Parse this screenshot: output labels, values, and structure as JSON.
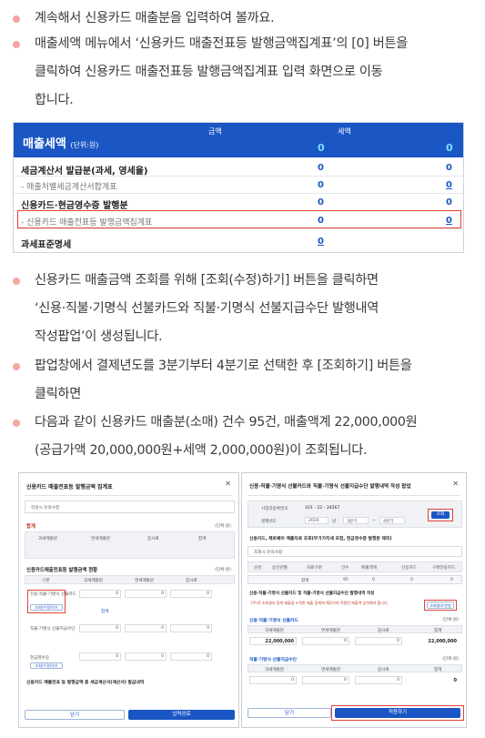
{
  "bullets": [
    "계속해서 신용카드 매출분을 입력하여 볼까요.",
    "매출세액 메뉴에서 ‘신용카드 매출전표등 발행금액집계표’의 [0] 버튼을\n클릭하여 신용카드 매출전표등 발행금액집계표 입력 화면으로 이동\n합니다.",
    "신용카드 매출금액 조회를 위해 [조회(수정)하기] 버튼을 클릭하면\n‘신용·직불·기명식 선불카드와 직불·기명식 선불지급수단 발행내역\n작성팝업’이 생성됩니다.",
    "팝업창에서 결제년도를 3분기부터 4분기로 선택한 후 [조회하기] 버튼을\n클릭하면",
    "다음과 같이 신용카드 매출분(소매) 건수 95건, 매출액계 22,000,000원\n(공급가액 20,000,000원+세액 2,000,000원)이 조회됩니다."
  ],
  "sales_table": {
    "title": "매출세액",
    "unit": "(단위:원)",
    "col_amount": "금액",
    "col_tax": "세액",
    "header_amount": "0",
    "header_tax": "0",
    "rows": [
      {
        "label": "세금계산서 발급분(과세, 영세율)",
        "amount": "0",
        "tax": "0",
        "style": "b"
      },
      {
        "label": "- 매출처별세금계산서합계표",
        "amount": "0",
        "tax": "0",
        "style": "s"
      },
      {
        "label": "신용카드·현금영수증 발행분",
        "amount": "0",
        "tax": "0",
        "style": "b"
      },
      {
        "label": "- 신용카드 매출전표등 발행금액집계표",
        "amount": "0",
        "tax": "0",
        "style": "s"
      },
      {
        "label": "과세표준명세",
        "amount": "0",
        "tax": "",
        "style": "b"
      }
    ]
  },
  "left_popup": {
    "title": "신용카드 매출전표등 발행금액 집계표",
    "notice": "작성시 유의사항",
    "sum_label": "합계",
    "unit": "(단위:원)",
    "sum_cols": [
      "과세매출분",
      "면세매출분",
      "봉사료",
      "합계"
    ],
    "section2": "신용카드매출전표등 발행금액 현황",
    "cols2": [
      "구분",
      "과세매출분",
      "면세매출분",
      "봉사료",
      "합계"
    ],
    "row1": "신용·직불·기명식 선불카드",
    "row1_btn": "조회(수정)하기",
    "row2": "직불·기명식 선불지급수단",
    "row3": "현금영수증",
    "row3_btn": "조회(수정)하기",
    "zero": "0",
    "sum_row": "합계",
    "section3": "신용카드 매출전표 등 발행금액 중 세금계산서(계산서) 발급내역",
    "btn_close": "닫기",
    "btn_done": "입력완료"
  },
  "right_popup": {
    "title": "신용·직불·기명식 선불카드와 직불·기명식 선불지급수단 발행내역 작성 팝업",
    "bizno_label": "사업자등록번호",
    "bizno": "101 - 22 - 34567",
    "year_label": "결제년도",
    "year": "2024",
    "from_q": "3분기",
    "to_q": "4분기",
    "range_sep": "년",
    "tilde": "~",
    "btn_search": "조회",
    "desc": "신용카드, 제로페이 매출자료 조회(부가가치세 포함, 현금영수증 발행분 제외)",
    "notice": "조회시 유의사항",
    "cols": [
      "순번",
      "승인년월",
      "자료구분",
      "건수",
      "매출액계",
      "신용카드",
      "구매전용카드"
    ],
    "sum_row": "합계",
    "sum_vals": [
      "95",
      "0",
      "0",
      "0"
    ],
    "section": "신용·직불·기명식 선불카드 및 직불·기명식 선불지급수단 발행내역 작성",
    "warning": "[주의] 조회결과 합계 매출을 누적한 매출 합계에 해당하여 적용된 매출액 입력해야 합니다.",
    "btn_reflect": "조회결과 반영",
    "sub1": "신용·직불·기명식 선불카드",
    "sub2": "직불·기명식 선불지급수단",
    "unit": "(단위:원)",
    "sub_cols": [
      "과세매출분",
      "면세매출분",
      "봉사료",
      "합계"
    ],
    "sub1_vals": [
      "22,000,000",
      "0",
      "0",
      "22,000,000"
    ],
    "sub2_vals": [
      "0",
      "0",
      "0",
      "0"
    ],
    "btn_close": "닫기",
    "btn_apply": "적용하기"
  }
}
